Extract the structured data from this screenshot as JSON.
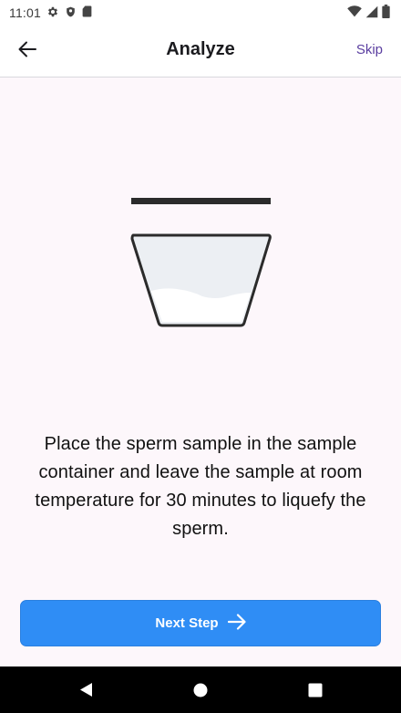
{
  "status_bar": {
    "time": "11:01",
    "left_icons": [
      "gear-icon",
      "shield-icon",
      "sd-card-icon"
    ],
    "right_icons": [
      "wifi-icon",
      "signal-icon",
      "battery-icon"
    ]
  },
  "app_bar": {
    "back_icon": "arrow-left-icon",
    "title": "Analyze",
    "skip_label": "Skip"
  },
  "illustration": {
    "name": "sample-container",
    "colors": {
      "outline": "#2b2b2b",
      "fill": "#eceff3",
      "liquid": "#ffffff"
    }
  },
  "instruction_text": "Place the sperm sample in the sample container and leave the sample at room temperature for 30 minutes to liquefy the sperm.",
  "next_button": {
    "label": "Next Step",
    "icon": "arrow-right-icon",
    "color": "#2f8df5"
  },
  "nav_bar": {
    "icons": [
      "back-triangle-icon",
      "home-circle-icon",
      "recents-square-icon"
    ]
  },
  "colors": {
    "background": "#fdf7fb",
    "accent": "#5a3ea0"
  }
}
